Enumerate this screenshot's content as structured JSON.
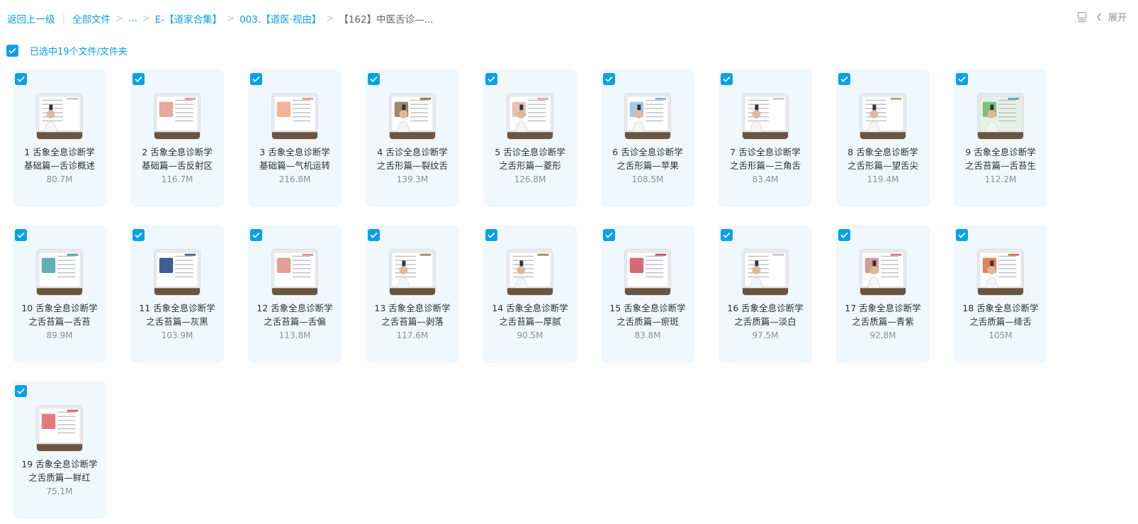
{
  "breadcrumb": {
    "back": "返回上一级",
    "all_files": "全部文件",
    "ellipsis": "...",
    "level1": "E-【道家合集】",
    "level2": "003.【道医·视由】",
    "current": "【162】中医舌诊—...",
    "sep": ">"
  },
  "toolbar": {
    "expand_label": "展开"
  },
  "selection": {
    "text": "已选中19个文件/文件夹"
  },
  "colors": {
    "accent": "#09a0ea",
    "card_bg": "#f0f8fd"
  },
  "files": [
    {
      "name": "1 舌象全息诊断学\n基础篇—舌诊概述",
      "size": "80.7M"
    },
    {
      "name": "2 舌象全息诊断学\n基础篇—舌反射区",
      "size": "116.7M"
    },
    {
      "name": "3 舌象全息诊断学\n基础篇—气机运转",
      "size": "216.8M"
    },
    {
      "name": "4 舌诊全息诊断学\n之舌形篇—裂纹舌",
      "size": "139.3M"
    },
    {
      "name": "5 舌诊全息诊断学\n之舌形篇—菱形",
      "size": "126.8M"
    },
    {
      "name": "6 舌诊全息诊断学\n之舌形篇—苹果",
      "size": "108.5M"
    },
    {
      "name": "7 舌诊全息诊断学\n之舌形篇—三角舌",
      "size": "83.4M"
    },
    {
      "name": "8 舌象全息诊断学\n之舌形篇—望舌尖",
      "size": "119.4M"
    },
    {
      "name": "9 舌象全息诊断学\n之舌苔篇—舌苔生",
      "size": "112.2M"
    },
    {
      "name": "10 舌象全息诊断学\n之舌苔篇—舌苔",
      "size": "89.9M"
    },
    {
      "name": "11 舌象全息诊断学\n之舌苔篇—灰黑",
      "size": "103.9M"
    },
    {
      "name": "12 舌象全息诊断学\n之舌苔篇—舌偏",
      "size": "113.8M"
    },
    {
      "name": "13 舌象全息诊断学\n之舌苔篇—剥落",
      "size": "117.6M"
    },
    {
      "name": "14 舌象全息诊断学\n之舌苔篇—厚腻",
      "size": "90.5M"
    },
    {
      "name": "15 舌象全息诊断学\n之舌质篇—瘀斑",
      "size": "83.8M"
    },
    {
      "name": "16 舌象全息诊断学\n之舌质篇—淡白",
      "size": "97.5M"
    },
    {
      "name": "17 舌象全息诊断学\n之舌质篇—青紫",
      "size": "92.8M"
    },
    {
      "name": "18 舌象全息诊断学\n之舌质篇—绛舌",
      "size": "105M"
    },
    {
      "name": "19 舌象全息诊断学\n之舌质篇—鲜红",
      "size": "75.1M"
    }
  ]
}
